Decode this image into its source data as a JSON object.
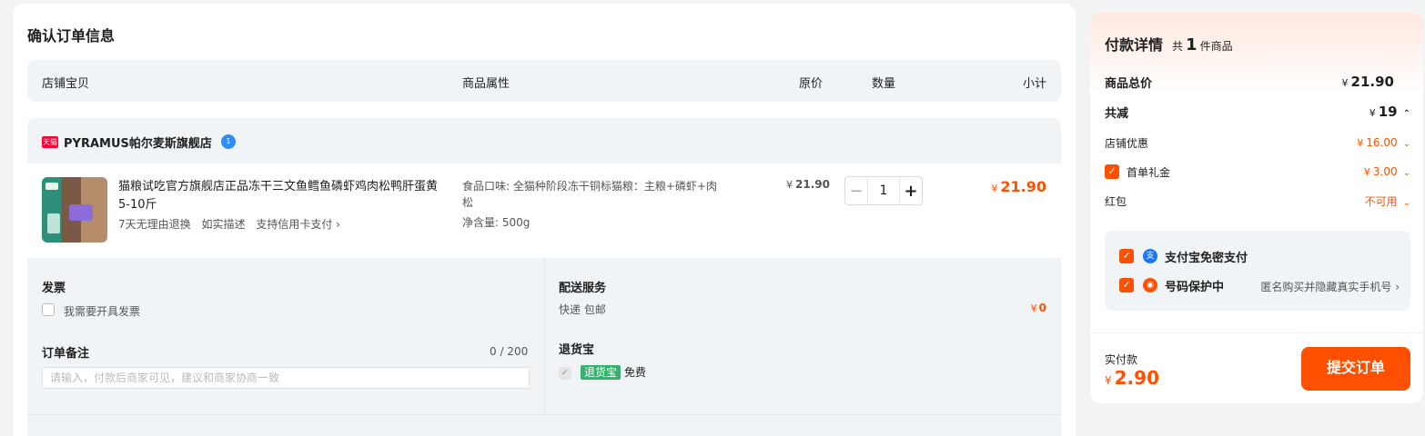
{
  "page": {
    "title": "确认订单信息"
  },
  "table_header": {
    "col_item": "店铺宝贝",
    "col_attr": "商品属性",
    "col_price": "原价",
    "col_qty": "数量",
    "col_subtotal": "小计"
  },
  "shop": {
    "badge": "天猫",
    "name": "PYRAMUS帕尔麦斯旗舰店",
    "ww_badge": "1"
  },
  "item": {
    "title": "猫粮试吃官方旗舰店正品冻干三文鱼鳕鱼磷虾鸡肉松鸭肝蛋黄5-10斤",
    "tags": [
      "7天无理由退换",
      "如实描述",
      "支持信用卡支付 ›"
    ],
    "attr_flavor": "食品口味: 全猫种阶段冻干铜标猫粮：主粮+磷虾+肉松",
    "attr_weight": "净含量: 500g",
    "currency": "¥",
    "orig_price": "21.90",
    "qty": "1",
    "subtotal": "21.90"
  },
  "invoice": {
    "label": "发票",
    "option": "我需要开具发票"
  },
  "remark": {
    "label": "订单备注",
    "count": "0 / 200",
    "placeholder": "请输入，付款后商家可见，建议和商家协商一致"
  },
  "delivery": {
    "label": "配送服务",
    "method": "快递 包邮",
    "fee": "0"
  },
  "return_insurance": {
    "label": "退货宝",
    "badge": "退货宝",
    "status": "免费"
  },
  "payment": {
    "title": "付款详情",
    "count_prefix": "共",
    "count": "1",
    "count_suffix": "件商品",
    "total_label": "商品总价",
    "total": "21.90",
    "discount_label": "共减",
    "discount": "19",
    "shop_coupon_label": "店铺优惠",
    "shop_coupon": "16.00",
    "first_gift_label": "首单礼金",
    "first_gift": "3.00",
    "redpacket_label": "红包",
    "redpacket": "不可用",
    "alipay_label": "支付宝免密支付",
    "privacy_label": "号码保护中",
    "privacy_desc": "匿名购买并隐藏真实手机号 ›",
    "actual_label": "实付款",
    "actual": "2.90",
    "submit": "提交订单"
  },
  "colors": {
    "accent": "#ff5000",
    "tmall": "#ff0036",
    "alipay": "#1677ff",
    "green": "#33b36b"
  },
  "icons": [
    "tmall-icon",
    "wangwang-icon",
    "checkbox-icon",
    "alipay-icon",
    "shield-icon",
    "chevron-down-icon",
    "chevron-up-icon",
    "check-icon"
  ]
}
